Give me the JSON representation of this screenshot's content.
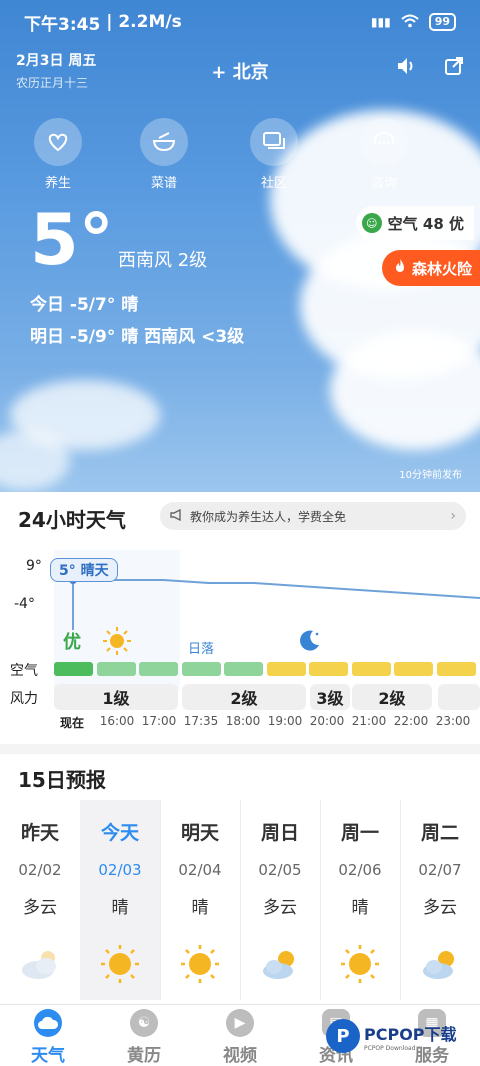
{
  "status_bar": {
    "time": "下午3:45",
    "speed": "2.2M/s",
    "battery": "99"
  },
  "header": {
    "date": "2月3日 周五",
    "lunar": "农历正月十三",
    "city_plus": "+",
    "city": "北京",
    "sound_icon": "speaker-icon",
    "share_icon": "share-icon"
  },
  "quick_links": [
    {
      "label": "养生",
      "icon": "heart-hands-icon"
    },
    {
      "label": "菜谱",
      "icon": "bowl-icon"
    },
    {
      "label": "社区",
      "icon": "chat-icon"
    },
    {
      "label": "咨询",
      "icon": "headset-icon"
    }
  ],
  "current": {
    "temp": "5°",
    "wind": "西南风 2级",
    "today": "今日 -5/7° 晴",
    "tomorrow": "明日 -5/9° 晴 西南风 <3级",
    "air_quality": "空气 48 优",
    "fire_risk": "森林火险",
    "published": "10分钟前发布"
  },
  "hourly": {
    "title": "24小时天气",
    "promo": "教你成为养生达人，学费全免",
    "high_label": "9°",
    "low_label": "-4°",
    "tooltip": "5° 晴天",
    "aq_text": "优",
    "sunset_text": "日落",
    "air_label": "空气",
    "wind_label": "风力",
    "now_label": "现在",
    "temps": [
      5,
      5,
      5,
      4,
      4,
      3,
      2,
      1,
      0,
      -1
    ],
    "aq_levels": [
      "good",
      "good",
      "good",
      "good",
      "good",
      "fair",
      "fair",
      "fair",
      "fair",
      "fair"
    ],
    "wind_groups": [
      "1级",
      "2级",
      "3级",
      "2级"
    ],
    "times": [
      "16:00",
      "17:00",
      "17:35",
      "18:00",
      "19:00",
      "20:00",
      "21:00",
      "22:00",
      "23:00"
    ],
    "colors": {
      "good": "#8fd49a",
      "now": "#4cbc5c",
      "fair": "#f5d24b"
    }
  },
  "forecast": {
    "title": "15日预报",
    "days": [
      {
        "name": "昨天",
        "date": "02/02",
        "weather": "多云",
        "icon": "cloudy"
      },
      {
        "name": "今天",
        "date": "02/03",
        "weather": "晴",
        "icon": "sunny"
      },
      {
        "name": "明天",
        "date": "02/04",
        "weather": "晴",
        "icon": "sunny"
      },
      {
        "name": "周日",
        "date": "02/05",
        "weather": "多云",
        "icon": "partly-cloudy"
      },
      {
        "name": "周一",
        "date": "02/06",
        "weather": "晴",
        "icon": "sunny"
      },
      {
        "name": "周二",
        "date": "02/07",
        "weather": "多云",
        "icon": "partly-cloudy"
      }
    ]
  },
  "nav": [
    {
      "label": "天气",
      "icon": "cloud-icon",
      "active": true
    },
    {
      "label": "黄历",
      "icon": "yinyang-icon",
      "active": false
    },
    {
      "label": "视频",
      "icon": "play-icon",
      "active": false
    },
    {
      "label": "资讯",
      "icon": "news-icon",
      "active": false
    },
    {
      "label": "服务",
      "icon": "grid-icon",
      "active": false
    }
  ],
  "watermark": {
    "logo": "P",
    "text": "PCPOP下载",
    "sub": "PCPOP Download"
  }
}
